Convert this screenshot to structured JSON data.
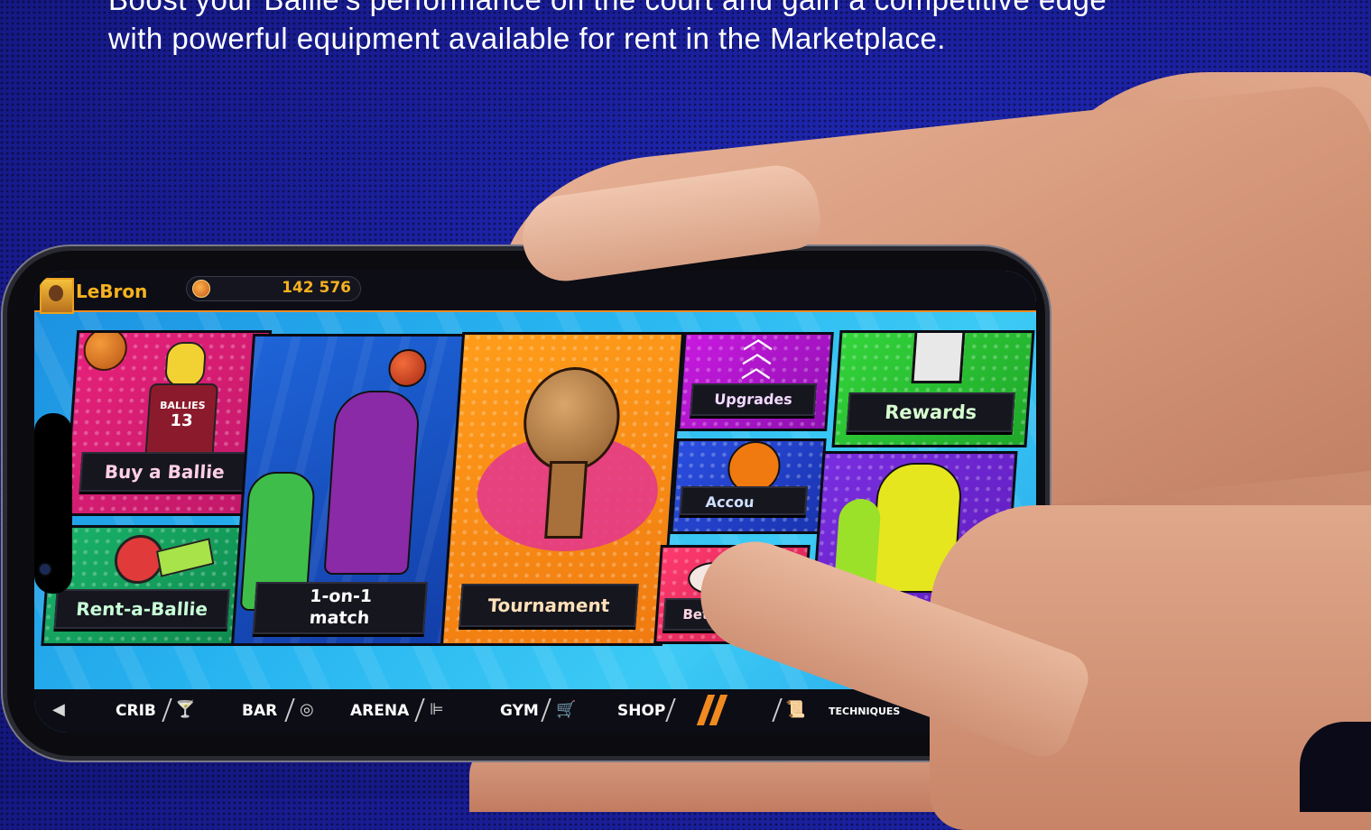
{
  "headline": {
    "line1": "Boost your Ballie's performance on the court and gain a competitive edge",
    "line2": "with powerful equipment available for rent in the Marketplace."
  },
  "game": {
    "player_name": "LeBron",
    "coin_balance": "142 576",
    "tiles": {
      "buy_ballie": "Buy a Ballie",
      "rent_ballie": "Rent-a-Ballie",
      "one_on_one": "1-on-1\nmatch",
      "tournament": "Tournament",
      "upgrades": "Upgrades",
      "rewards": "Rewards",
      "account": "Accou",
      "bet_friend": "Bet a friend",
      "jersey_name": "BALLIES",
      "jersey_number": "13"
    },
    "nav": {
      "crib": "CRIB",
      "bar": "BAR",
      "arena": "ARENA",
      "gym": "GYM",
      "shop": "SHOP",
      "techniques": "TECHNIQUES"
    }
  },
  "colors": {
    "background": "#1a1f9c",
    "accent_orange": "#f08a20",
    "gold_text": "#f6b21f",
    "screen_blue": "#27b4f0"
  }
}
